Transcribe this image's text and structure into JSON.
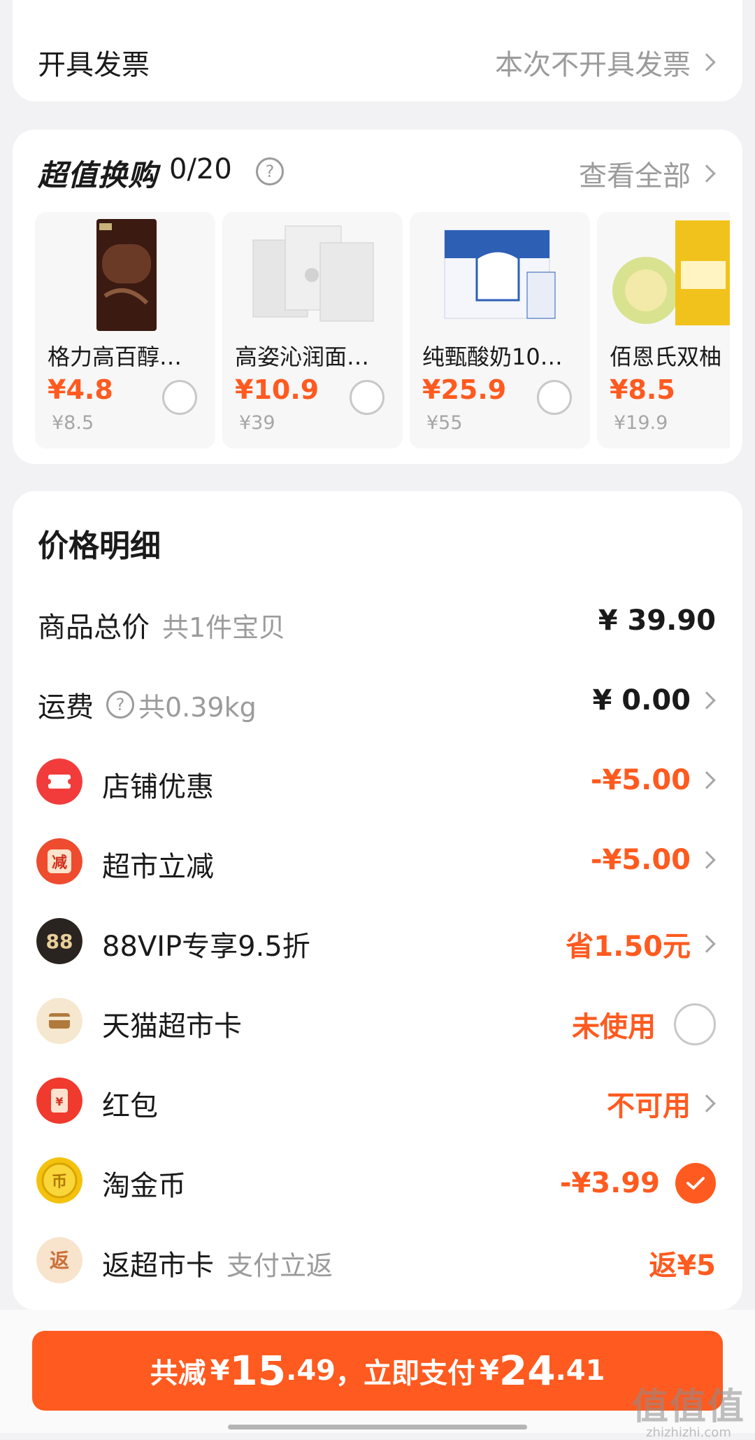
{
  "invoice": {
    "title": "开具发票",
    "value": "本次不开具发票"
  },
  "swap": {
    "title": "超值换购",
    "count": "0/20",
    "help_icon": "question-circle-icon",
    "view_all": "查看全部",
    "products": [
      {
        "name": "格力高百醇…",
        "price": "¥4.8",
        "original": "¥8.5"
      },
      {
        "name": "高姿沁润面…",
        "price": "¥10.9",
        "original": "¥39"
      },
      {
        "name": "纯甄酸奶10…",
        "price": "¥25.9",
        "original": "¥55"
      },
      {
        "name": "佰恩氏双柚",
        "price": "¥8.5",
        "original": "¥19.9"
      }
    ]
  },
  "details": {
    "title": "价格明细",
    "goods": {
      "label": "商品总价",
      "sub": "共1件宝贝",
      "value": "¥ 39.90"
    },
    "shipping": {
      "label": "运费",
      "sub": "共0.39kg",
      "value": "¥ 0.00"
    },
    "store_discount": {
      "label": "店铺优惠",
      "value": "-¥5.00",
      "icon": "ticket-icon"
    },
    "market_discount": {
      "label": "超市立减",
      "value": "-¥5.00",
      "icon": "jian-discount-icon",
      "icon_text": "减"
    },
    "vip": {
      "label": "88VIP专享9.5折",
      "value": "省1.50元",
      "icon": "vip-88-icon",
      "icon_text": "88"
    },
    "tmall_card": {
      "label": "天猫超市卡",
      "value": "未使用",
      "icon": "card-icon"
    },
    "red_packet": {
      "label": "红包",
      "value": "不可用",
      "icon": "red-packet-icon",
      "icon_text": "¥"
    },
    "gold_coin": {
      "label": "淘金币",
      "value": "-¥3.99",
      "icon": "gold-coin-icon",
      "icon_text": "币"
    },
    "rebate": {
      "label": "返超市卡",
      "sub": "支付立返",
      "value": "返¥5",
      "icon": "rebate-icon",
      "icon_text": "返"
    }
  },
  "pay": {
    "prefix": "共减",
    "reduce_currency": "¥",
    "reduce_int": "15",
    "reduce_dec": ".49",
    "middle": "，立即支付",
    "pay_currency": "¥",
    "pay_int": "24",
    "pay_dec": ".41"
  },
  "watermark": {
    "main": "值值值",
    "sub": "zhizhizhi.com"
  },
  "colors": {
    "accent": "#ff5a1f",
    "background": "#f2f2f4"
  }
}
